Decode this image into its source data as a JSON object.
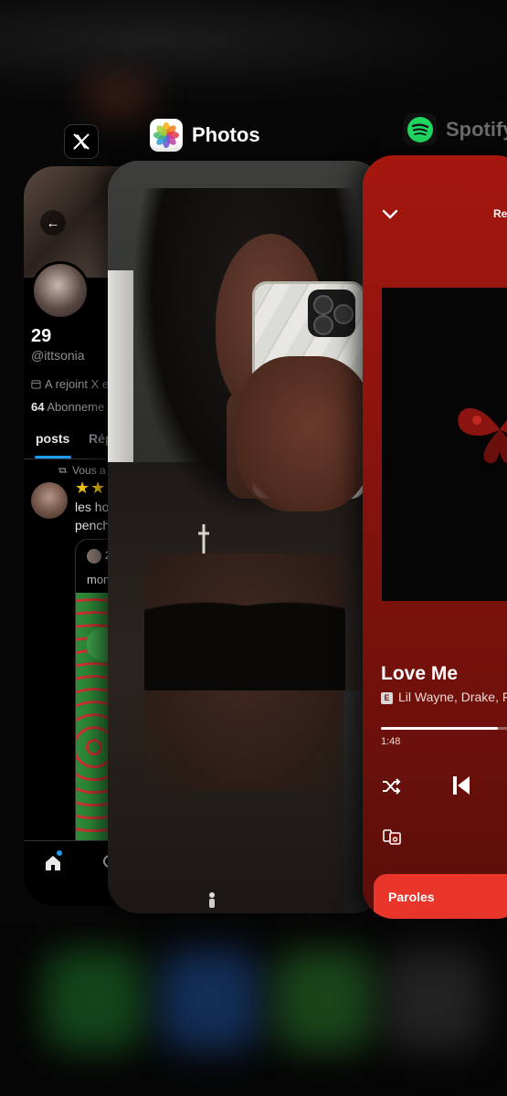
{
  "app_switcher": {
    "apps": [
      {
        "name": "X",
        "icon": "x-logo-icon",
        "label": ""
      },
      {
        "name": "Photos",
        "icon": "photos-icon",
        "label": "Photos"
      },
      {
        "name": "Spotify",
        "icon": "spotify-icon",
        "label": "Spotify"
      }
    ]
  },
  "x_card": {
    "back_icon": "arrow-left-icon",
    "count": "29",
    "handle": "@ittsonia",
    "joined": "A rejoint X e",
    "follow_count": "64",
    "follow_label": " Abonneme",
    "tabs": [
      {
        "label": "posts",
        "active": true
      },
      {
        "label": "Rép",
        "active": false
      }
    ],
    "repost_label": "Vous a",
    "post_stars": "★★",
    "post_text_line1": "les ho",
    "post_text_line2": "pench",
    "quote_author": "2",
    "quote_text": "mon",
    "nav": {
      "home_icon": "home-icon",
      "search_icon": "search-icon"
    },
    "colors": {
      "accent": "#1d9bf0",
      "background": "#000000"
    }
  },
  "photos_card": {
    "image": "mirror-selfie-photo"
  },
  "spotify_card": {
    "header_label": "Re",
    "track_title": "Love Me",
    "explicit_badge": "E",
    "artists": "Lil Wayne, Drake, F",
    "elapsed_time": "1:48",
    "progress_fraction": 0.75,
    "lyrics_label": "Paroles",
    "colors": {
      "background": "#a5170f",
      "lyrics": "#e9352a",
      "brand": "#1ed760"
    }
  }
}
